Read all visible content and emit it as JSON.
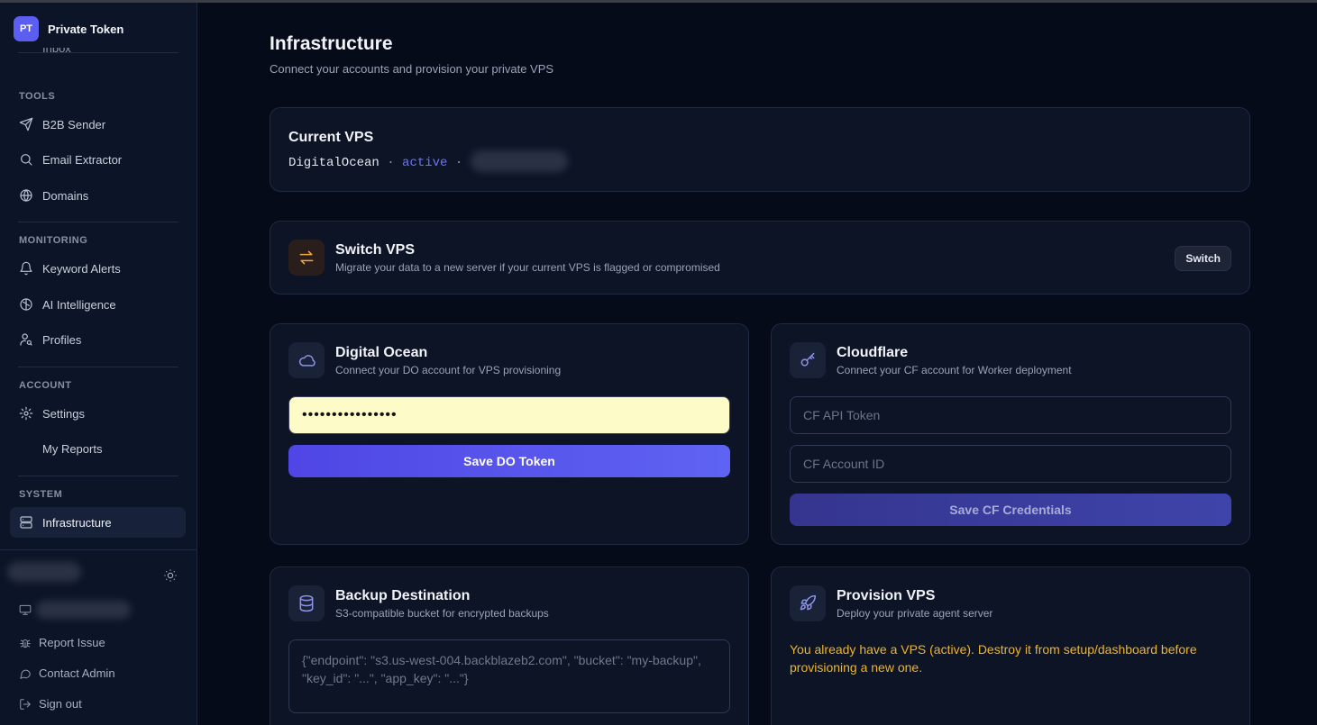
{
  "app": {
    "logo": "PT",
    "name": "Private Token"
  },
  "sidebar": {
    "cut_item": "Inbox",
    "sections": [
      {
        "label": "TOOLS",
        "items": [
          {
            "label": "B2B Sender",
            "icon": "send-icon"
          },
          {
            "label": "Email Extractor",
            "icon": "search-icon"
          },
          {
            "label": "Domains",
            "icon": "globe-icon"
          }
        ]
      },
      {
        "label": "MONITORING",
        "items": [
          {
            "label": "Keyword Alerts",
            "icon": "bell-icon"
          },
          {
            "label": "AI Intelligence",
            "icon": "brain-icon"
          },
          {
            "label": "Profiles",
            "icon": "user-search-icon"
          }
        ]
      },
      {
        "label": "ACCOUNT",
        "items": [
          {
            "label": "Settings",
            "icon": "gear-icon"
          },
          {
            "label": "My Reports",
            "icon": ""
          }
        ]
      },
      {
        "label": "SYSTEM",
        "items": [
          {
            "label": "Infrastructure",
            "icon": "server-icon",
            "active": true
          }
        ]
      }
    ],
    "footer": {
      "report_issue": "Report Issue",
      "contact_admin": "Contact Admin",
      "sign_out": "Sign out"
    }
  },
  "main": {
    "title": "Infrastructure",
    "subtitle": "Connect your accounts and provision your private VPS",
    "current_vps": {
      "title": "Current VPS",
      "provider": "DigitalOcean",
      "sep": "·",
      "status": "active"
    },
    "switch_vps": {
      "title": "Switch VPS",
      "subtitle": "Migrate your data to a new server if your current VPS is flagged or compromised",
      "button": "Switch"
    },
    "digital_ocean": {
      "title": "Digital Ocean",
      "subtitle": "Connect your DO account for VPS provisioning",
      "token_value": "••••••••••••••••",
      "button": "Save DO Token"
    },
    "cloudflare": {
      "title": "Cloudflare",
      "subtitle": "Connect your CF account for Worker deployment",
      "token_placeholder": "CF API Token",
      "account_placeholder": "CF Account ID",
      "button": "Save CF Credentials"
    },
    "backup": {
      "title": "Backup Destination",
      "subtitle": "S3-compatible bucket for encrypted backups",
      "placeholder": "{\"endpoint\": \"s3.us-west-004.backblazeb2.com\", \"bucket\": \"my-backup\", \"key_id\": \"...\", \"app_key\": \"...\"}"
    },
    "provision": {
      "title": "Provision VPS",
      "subtitle": "Deploy your private agent server",
      "warning": "You already have a VPS (active). Destroy it from setup/dashboard before provisioning a new one."
    }
  },
  "colors": {
    "accent": "#5b5ef0",
    "warning": "#f0b429",
    "status_active": "#6d73f5"
  }
}
